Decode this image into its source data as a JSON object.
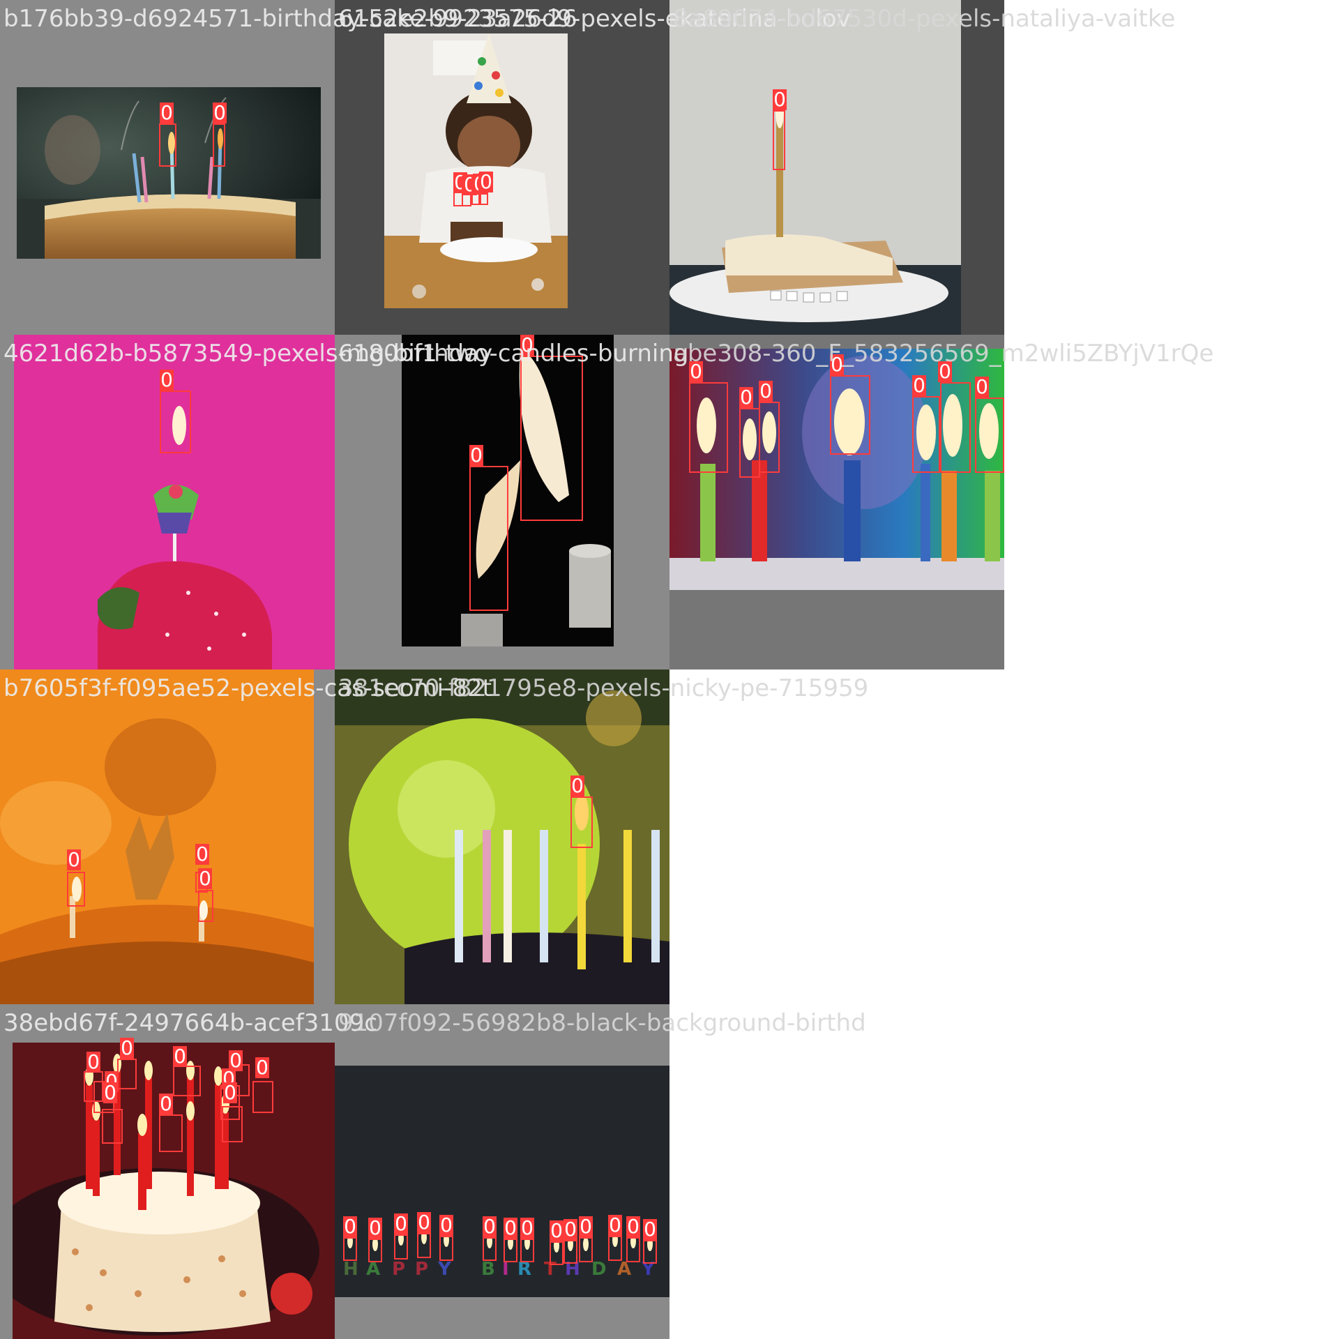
{
  "grid": {
    "box_color": "#ff3b3b",
    "tiles": [
      {
        "id": "t1",
        "filename": "b176bb39-d6924571-birthday-cake-9923575-26",
        "labels": [
          "0",
          "0"
        ]
      },
      {
        "id": "t2",
        "filename": "6152e2b9-23a26d9-pexels-ekaterina-bolov",
        "labels": [
          "0",
          "0",
          "0",
          "0"
        ]
      },
      {
        "id": "t3",
        "filename": "8a89074-bd67530d-pexels-nataliya-vaitke",
        "labels": [
          "0"
        ]
      },
      {
        "id": "t4",
        "filename": "4621d62b-b5873549-pexels-mg-birthday",
        "labels": [
          "0"
        ]
      },
      {
        "id": "t5",
        "filename": "6180bf1-two-candles-burning",
        "labels": [
          "0",
          "0"
        ]
      },
      {
        "id": "t6",
        "filename": "abe308-360_F_583256569_m2wli5ZBYjV1rQe",
        "labels": [
          "0",
          "0",
          "0",
          "0",
          "0",
          "0",
          "0"
        ]
      },
      {
        "id": "t7",
        "filename": "b7605f3f-f095ae52-pexels-cas-seomi-82t",
        "labels": [
          "0",
          "0",
          "0"
        ]
      },
      {
        "id": "t8",
        "filename": "381cc70-f821795e8-pexels-nicky-pe-715959",
        "labels": [
          "0"
        ]
      },
      {
        "id": "t9",
        "filename": "38ebd67f-2497664b-acef3109c",
        "labels": [
          "0",
          "0",
          "0",
          "0",
          "0",
          "0",
          "0",
          "0",
          "0",
          "0"
        ]
      },
      {
        "id": "t10",
        "filename": "9107f092-56982b8-black-background-birthd",
        "labels": [
          "0",
          "0",
          "0",
          "0",
          "0",
          "0",
          "0",
          "0",
          "0",
          "0",
          "0",
          "0",
          "0",
          "0"
        ]
      }
    ]
  }
}
